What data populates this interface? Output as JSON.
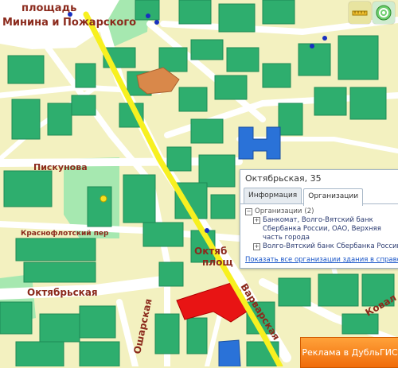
{
  "map": {
    "street_labels": {
      "ploshchad": "площадь",
      "minin": "Минина и Пожарского",
      "piskunova": "Пискунова",
      "krasnoflot": "Краснофлотский пер",
      "oktyabrskaya": "Октябрьская",
      "ossharskaya": "Ошарская",
      "oktyabr_ploshch_a": "Октяб",
      "oktyabr_ploshch_b": "площ",
      "varvarskaya": "Варварская",
      "koval": "Ковал"
    },
    "colors": {
      "background": "#f3f1c0",
      "building_fill": "#2eae6e",
      "building_dark": "#1f8a55",
      "park_fill": "#a6e8b0",
      "road": "#ffffff",
      "route": "#f7f020",
      "highlight_building": "#e81414",
      "blue_building": "#2a72d8",
      "orange_building": "#d9884a",
      "label_red": "#8b2a1c"
    }
  },
  "toolbar": {
    "ruler_icon": "ruler-icon",
    "globe_icon": "globe-icon"
  },
  "popup": {
    "title": "Октябрьская, 35",
    "tabs": [
      "Информация",
      "Организации"
    ],
    "active_tab": "Организации",
    "group_label": "Организации",
    "group_count": "(2)",
    "organizations": [
      "Банкомат, Волго-Вятский банк Сбербанка России, ОАО, Верхняя часть города",
      "Волго-Вятский банк Сбербанка России, О"
    ],
    "show_all_link": "Показать все организации здания в справочн"
  },
  "ad_button": {
    "label": "Реклама в ДубльГИС"
  }
}
